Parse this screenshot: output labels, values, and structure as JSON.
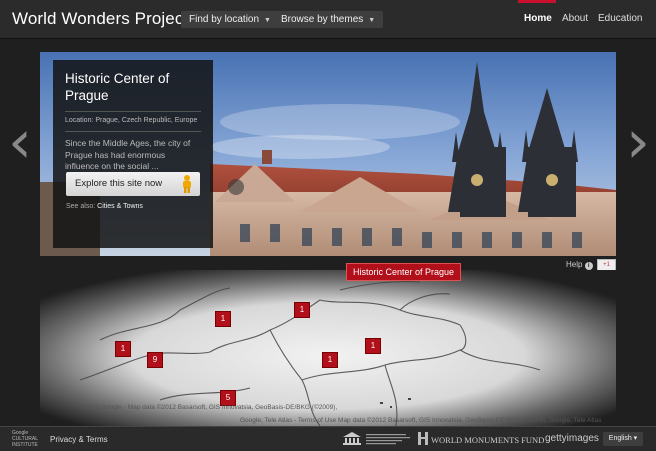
{
  "header": {
    "brand": "World Wonders Project",
    "find_by_location": "Find by location",
    "browse_by_themes": "Browse by themes",
    "nav": [
      "Home",
      "About",
      "Education"
    ],
    "accent": "#c8102e"
  },
  "site": {
    "title": "Historic Center of Prague",
    "location": "Location: Prague, Czech Republic, Europe",
    "description": "Since the Middle Ages, the city of Prague has had enormous influence on the social ...",
    "explore_label": "Explore this site now",
    "see_also_prefix": "See also: ",
    "see_also_link": "Cities & Towns"
  },
  "hero_icons": {
    "prev": "chevron-left-icon",
    "next": "chevron-right-icon",
    "pegman": "pegman-icon"
  },
  "help": {
    "label": "Help",
    "icon": "i",
    "gplus": "+1"
  },
  "map": {
    "selected_label": "Historic Center of Prague",
    "markers": [
      "1",
      "1",
      "1",
      "1",
      "9",
      "1",
      "5"
    ],
    "copyright_1": "©2012 Google - Map data ©2012 Basarsoft, GIS Innovatsia, GeoBasis-DE/BKG (©2009),",
    "copyright_2": "Google, Tele Atlas - Terms of Use Map data ©2012 Basarsoft, GIS Innovatsia, GeoBasis-DE/BKG (©2009), Google, Tele Atlas"
  },
  "footer": {
    "gci_line1": "Google",
    "gci_line2": "CULTURAL",
    "gci_line3": "INSTITUTE",
    "privacy": "Privacy & Terms",
    "wmf": "WORLD MONUMENTS FUND",
    "getty": "gettyimages",
    "language": "English ▾"
  }
}
